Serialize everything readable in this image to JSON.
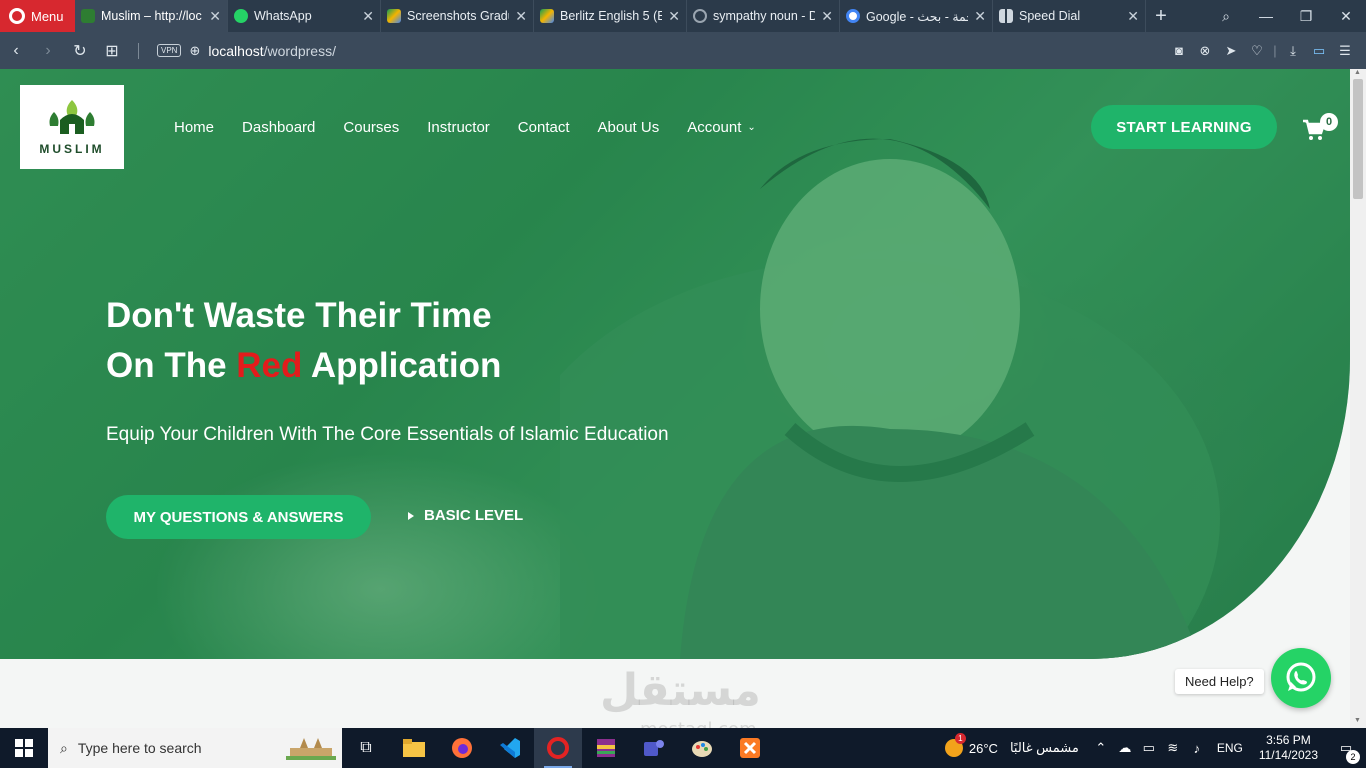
{
  "browser": {
    "menu_label": "Menu",
    "tabs": [
      {
        "title": "Muslim – http://loc",
        "active": true,
        "favicon_color": "#2e7d32"
      },
      {
        "title": "WhatsApp",
        "active": false,
        "favicon_color": "#25d366"
      },
      {
        "title": "Screenshots Gradu",
        "active": false,
        "favicon_color": "#f4b400"
      },
      {
        "title": "Berlitz English 5 (E",
        "active": false,
        "favicon_color": "#f4b400"
      },
      {
        "title": "sympathy noun - D",
        "active": false,
        "favicon_color": "#8a8a8a"
      },
      {
        "title": "Google - ترجمة - بحث",
        "active": false,
        "favicon_color": "#4285f4"
      },
      {
        "title": "Speed Dial",
        "active": false,
        "favicon_color": "#cccccc"
      }
    ],
    "url_host": "localhost",
    "url_path": "/wordpress/",
    "vpn_label": "VPN"
  },
  "site": {
    "logo_text": "MUSLIM",
    "nav": [
      {
        "label": "Home"
      },
      {
        "label": "Dashboard"
      },
      {
        "label": "Courses"
      },
      {
        "label": "Instructor"
      },
      {
        "label": "Contact"
      },
      {
        "label": "About Us"
      },
      {
        "label": "Account"
      }
    ],
    "cta_label": "START LEARNING",
    "cart_count": "0",
    "headline_line1": "Don't Waste Their Time",
    "headline_line2_pre": "On The ",
    "headline_line2_red": "Red",
    "headline_line2_post": " Application",
    "subline": "Equip Your Children With The Core Essentials of Islamic Education",
    "btn_qa": "MY QUESTIONS & ANSWERS",
    "btn_basic": "BASIC LEVEL",
    "need_help": "Need Help?",
    "watermark": "مستقل",
    "watermark_sub": "mostaql.com",
    "colors": {
      "accent": "#1fb46a",
      "headline_red": "#e31c1c",
      "whatsapp": "#25d366"
    }
  },
  "taskbar": {
    "search_placeholder": "Type here to search",
    "weather_temp": "26°C",
    "weather_text": "مشمس غالبًا",
    "weather_badge": "1",
    "lang": "ENG",
    "time": "3:56 PM",
    "date": "11/14/2023",
    "notifications": "2"
  }
}
